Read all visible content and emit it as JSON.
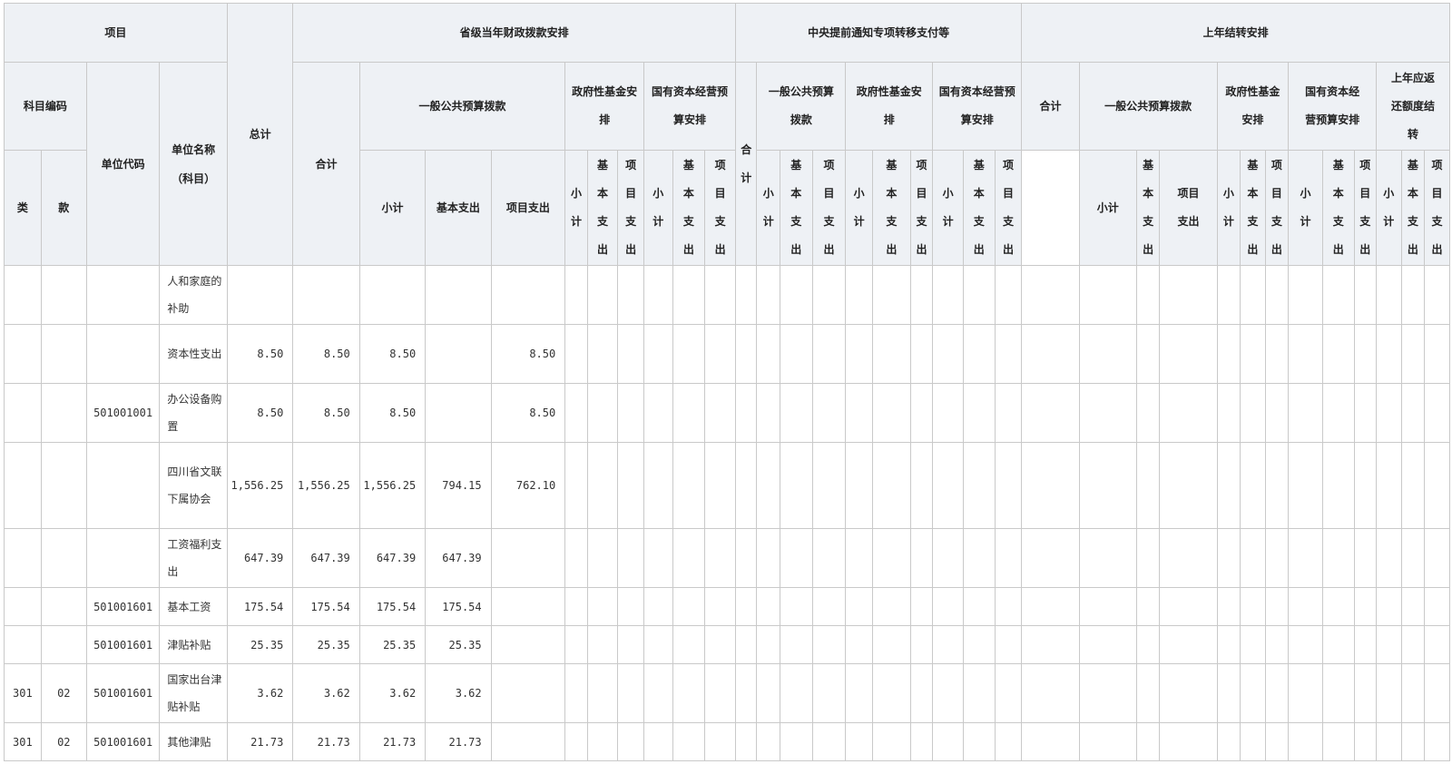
{
  "header": {
    "project": "项目",
    "subject_code": "科目编码",
    "category": "类",
    "section": "款",
    "unit_code": "单位代码",
    "unit_name_line1": "单位名称",
    "unit_name_line2": "（科目）",
    "total": "总计",
    "groupA": "省级当年财政拨款安排",
    "groupB": "中央提前通知专项转移支付等",
    "groupC": "上年结转安排",
    "heji": "合计",
    "general_budget": "一般公共预算拨款",
    "general_budget_wrap": "一般公共预算拨款",
    "gov_fund": "政府性基金安排",
    "gov_fund_c": "政府性基金安排",
    "state_capital": "国有资本经营预算安排",
    "state_capital_c": "国有资本经营预算安排",
    "prior_return": "上年应返还额度结转",
    "subtotal": "小计",
    "basic": "基本支出",
    "project_exp": "项目支出",
    "subtotal_v": "小计",
    "basic_v": "基本支出",
    "project_v": "项目支出",
    "heji_v": "合计"
  },
  "rows": [
    {
      "cat": "",
      "sec": "",
      "code": "",
      "name": "人和家庭的补助",
      "total": "",
      "heji": "",
      "sub": "",
      "basic": "",
      "proj": ""
    },
    {
      "cat": "",
      "sec": "",
      "code": "",
      "name": "资本性支出",
      "total": "8.50",
      "heji": "8.50",
      "sub": "8.50",
      "basic": "",
      "proj": "8.50"
    },
    {
      "cat": "",
      "sec": "",
      "code": "501001001",
      "name": "办公设备购置",
      "total": "8.50",
      "heji": "8.50",
      "sub": "8.50",
      "basic": "",
      "proj": "8.50"
    },
    {
      "cat": "",
      "sec": "",
      "code": "",
      "name": "四川省文联下属协会",
      "total": "1,556.25",
      "heji": "1,556.25",
      "sub": "1,556.25",
      "basic": "794.15",
      "proj": "762.10"
    },
    {
      "cat": "",
      "sec": "",
      "code": "",
      "name": "工资福利支出",
      "total": "647.39",
      "heji": "647.39",
      "sub": "647.39",
      "basic": "647.39",
      "proj": ""
    },
    {
      "cat": "",
      "sec": "",
      "code": "501001601",
      "name": "基本工资",
      "total": "175.54",
      "heji": "175.54",
      "sub": "175.54",
      "basic": "175.54",
      "proj": ""
    },
    {
      "cat": "",
      "sec": "",
      "code": "501001601",
      "name": "津贴补贴",
      "total": "25.35",
      "heji": "25.35",
      "sub": "25.35",
      "basic": "25.35",
      "proj": ""
    },
    {
      "cat": "301",
      "sec": "02",
      "code": "501001601",
      "name": "国家出台津贴补贴",
      "total": "3.62",
      "heji": "3.62",
      "sub": "3.62",
      "basic": "3.62",
      "proj": ""
    },
    {
      "cat": "301",
      "sec": "02",
      "code": "501001601",
      "name": "其他津贴",
      "total": "21.73",
      "heji": "21.73",
      "sub": "21.73",
      "basic": "21.73",
      "proj": ""
    }
  ]
}
